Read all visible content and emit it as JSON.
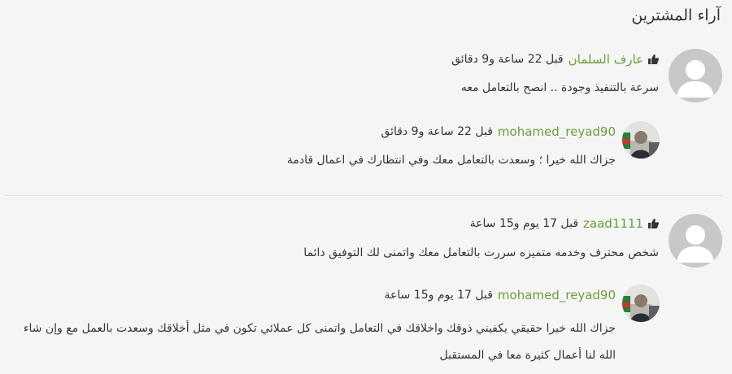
{
  "section_title": "آراء المشترين",
  "reviews": [
    {
      "buyer": {
        "name": "عارف السلمان",
        "time": "قبل 22 ساعة و9 دقائق",
        "text": "سرعة بالتنفيذ وجودة .. انصح بالتعامل معه"
      },
      "reply": {
        "name": "mohamed_reyad90",
        "time": "قبل 22 ساعة و9 دقائق",
        "text": "جزاك الله خيرا ؛ وسعدت بالتعامل معك وفي انتظارك في اعمال قادمة"
      }
    },
    {
      "buyer": {
        "name": "zaad1111",
        "time": "قبل 17 يوم و15 ساعة",
        "text": "شخص محترف وخدمه متميزه سررت بالتعامل معك واتمنى لك التوفيق دائما"
      },
      "reply": {
        "name": "mohamed_reyad90",
        "time": "قبل 17 يوم و15 ساعة",
        "text": "جزاك الله خيرا حقيقي يكفيني ذوقك واخلاقك في التعامل واتمنى كل عملائي تكون في مثل أخلاقك وسعدت بالعمل مع وإن شاء الله لنا أعمال كثيرة معا في المستقبل"
      }
    }
  ],
  "colors": {
    "background": "#f5f5f5",
    "username": "#6a9e3c",
    "avatar_placeholder": "#c8c8c8",
    "divider": "#e2e2e2"
  },
  "icons": {
    "positive_rating": "thumbs-up-icon",
    "avatar": "user-silhouette-icon"
  }
}
